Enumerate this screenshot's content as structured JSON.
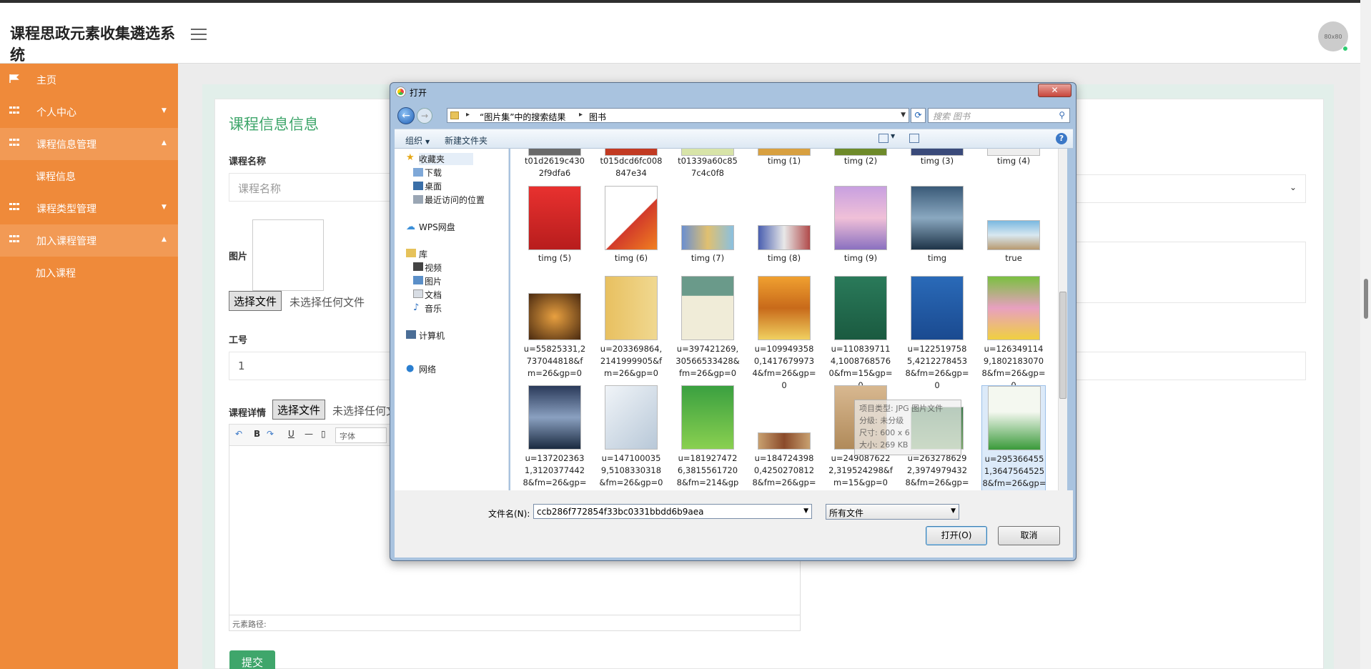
{
  "app": {
    "title": "课程思政元素收集遴选系统",
    "avatar_text": "80x80"
  },
  "sidebar": {
    "items": [
      {
        "label": "主页"
      },
      {
        "label": "个人中心"
      },
      {
        "label": "课程信息管理"
      },
      {
        "label": "课程信息"
      },
      {
        "label": "课程类型管理"
      },
      {
        "label": "加入课程管理"
      },
      {
        "label": "加入课程"
      }
    ]
  },
  "form": {
    "title": "课程信息信息",
    "course_name_label": "课程名称",
    "course_name_placeholder": "课程名称",
    "image_label": "图片",
    "choose_file": "选择文件",
    "no_file": "未选择任何文件",
    "job_id_label": "工号",
    "job_id_value": "1",
    "detail_label": "课程详情",
    "font_select": "字体",
    "editor_path": "元素路径:",
    "submit": "提交"
  },
  "dialog": {
    "title": "打开",
    "close": "✕",
    "breadcrumb": [
      "“图片集”中的搜索结果",
      "图书"
    ],
    "search_placeholder": "搜索 图书",
    "organize": "组织",
    "new_folder": "新建文件夹",
    "nav": {
      "favorites": "收藏夹",
      "downloads": "下载",
      "desktop": "桌面",
      "recent": "最近访问的位置",
      "wps": "WPS网盘",
      "libraries": "库",
      "videos": "视频",
      "pictures": "图片",
      "documents": "文档",
      "music": "音乐",
      "computer": "计算机",
      "network": "网络"
    },
    "rows": [
      [
        "t01d2619c4302f9dfa6",
        "t015dcd6fc008847e34",
        "t01339a60c857c4c0f8",
        "timg (1)",
        "timg (2)",
        "timg (3)",
        "timg (4)"
      ],
      [
        "timg (5)",
        "timg (6)",
        "timg (7)",
        "timg (8)",
        "timg (9)",
        "timg",
        "true"
      ],
      [
        "u=55825331,2737044818&fm=26&gp=0",
        "u=203369864,2141999905&fm=26&gp=0",
        "u=397421269,30566533428&fm=26&gp=0",
        "u=1099493580,14176799734&fm=26&gp=0",
        "u=1108397114,10087685760&fm=15&gp=0",
        "u=1225197585,42122784538&fm=26&gp=0",
        "u=1263491149,18021830708&fm=26&gp=0"
      ],
      [
        "u=1372023631,31203774428&fm=26&gp=0",
        "u=1471000359,5108330318&fm=26&gp=0",
        "u=1819274726,38155617208&fm=214&gp=0",
        "u=1847243980,42502708128&fm=26&gp=0",
        "u=2490876222,319524298&fm=15&gp=0",
        "u=2632786292,39749794328&fm=26&gp=0",
        "u=2953664551,36475645258&fm=26&gp=0"
      ]
    ],
    "tooltip": [
      "项目类型: JPG 图片文件",
      "分级: 未分级",
      "尺寸: 600 x 6",
      "大小: 269 KB"
    ],
    "filename_label": "文件名(N):",
    "filename_value": "ccb286f772854f33bc0331bbdd6b9aea",
    "filetype": "所有文件",
    "open_button": "打开(O)",
    "cancel_button": "取消"
  },
  "colors": {
    "sidebar": "#ef8a3a",
    "accent": "#3fa66b",
    "dialog_frame": "#a9c3df"
  }
}
